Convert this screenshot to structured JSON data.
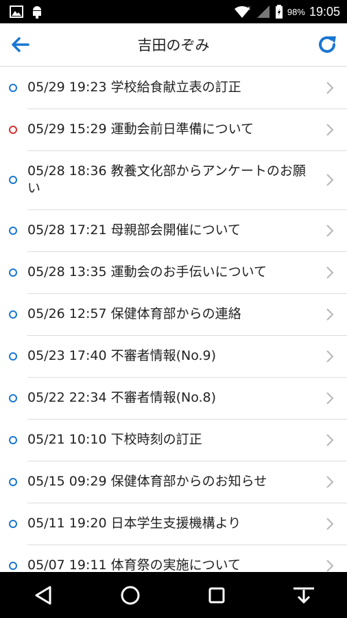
{
  "status_bar": {
    "battery": "98%",
    "time": "19:05"
  },
  "header": {
    "title": "吉田のぞみ",
    "back_icon": "arrow-left-icon",
    "refresh_icon": "refresh-icon",
    "accent_color": "#1976d2"
  },
  "messages": [
    {
      "text": "05/29 19:23 学校給食献立表の訂正",
      "dot": "blue"
    },
    {
      "text": "05/29 15:29 運動会前日準備について",
      "dot": "red"
    },
    {
      "text": "05/28 18:36 教養文化部からアンケートのお願い",
      "dot": "blue"
    },
    {
      "text": "05/28 17:21 母親部会開催について",
      "dot": "blue"
    },
    {
      "text": "05/28 13:35 運動会のお手伝いについて",
      "dot": "blue"
    },
    {
      "text": "05/26 12:57 保健体育部からの連絡",
      "dot": "blue"
    },
    {
      "text": "05/23 17:40 不審者情報(No.9)",
      "dot": "blue"
    },
    {
      "text": "05/22 22:34 不審者情報(No.8)",
      "dot": "blue"
    },
    {
      "text": "05/21 10:10 下校時刻の訂正",
      "dot": "blue"
    },
    {
      "text": "05/15 09:29 保健体育部からのお知らせ",
      "dot": "blue"
    },
    {
      "text": "05/11 19:20 日本学生支援機構より",
      "dot": "blue"
    },
    {
      "text": "05/07 19:11 体育祭の実施について",
      "dot": "blue"
    }
  ]
}
